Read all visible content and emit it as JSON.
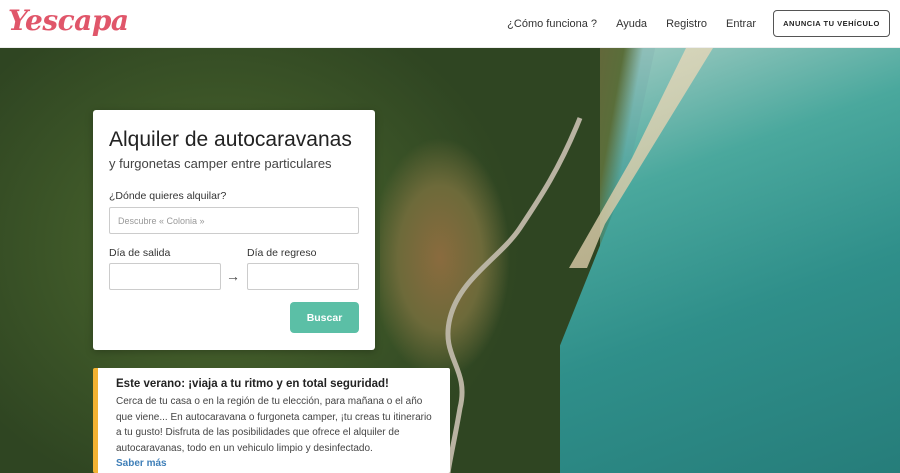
{
  "brand": {
    "logo_text": "Yescapa"
  },
  "nav": {
    "links": [
      "¿Cómo funciona ?",
      "Ayuda",
      "Registro",
      "Entrar"
    ],
    "cta_label": "ANUNCIA TU VEHÍCULO"
  },
  "search": {
    "title": "Alquiler de autocaravanas",
    "subtitle": "y furgonetas camper entre particulares",
    "where_label": "¿Dónde quieres alquilar?",
    "where_placeholder": "Descubre « Colonia »",
    "departure_label": "Día de salida",
    "return_label": "Día de regreso",
    "arrow": "→",
    "button_label": "Buscar"
  },
  "info": {
    "title": "Este verano: ¡viaja a tu ritmo y en total seguridad!",
    "body": "Cerca de tu casa o en la región de tu elección, para mañana o el año que viene... En autocaravana o furgoneta camper, ¡tu creas tu itinerario a tu gusto! Disfruta de las posibilidades que ofrece el alquiler de autocaravanas, todo en un vehiculo limpio y desinfectado.",
    "link": "Saber más"
  },
  "colors": {
    "accent": "#5bbfa6",
    "info_border": "#f2b233",
    "link": "#3f7fb8",
    "logo": "#e0566a"
  }
}
